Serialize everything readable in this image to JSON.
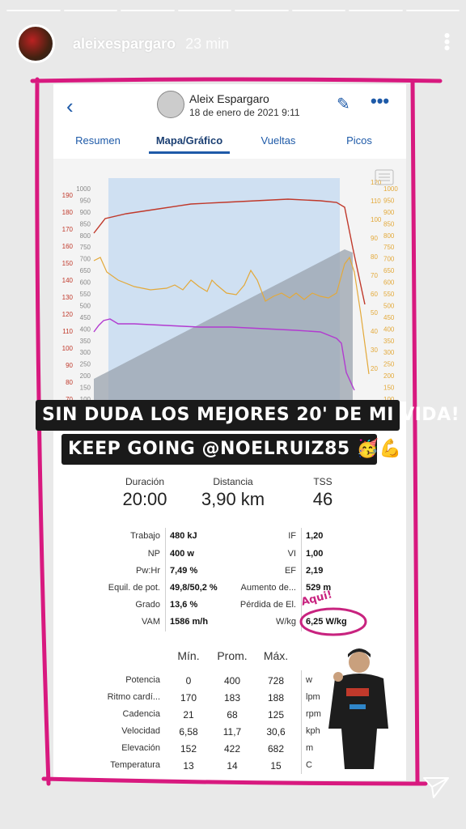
{
  "story": {
    "username": "aleixespargaro",
    "time": "23 min",
    "progress_segments": 8
  },
  "app": {
    "athlete_name": "Aleix Espargaro",
    "date": "18 de enero de 2021   9:11",
    "tabs": [
      {
        "label": "Resumen",
        "active": false
      },
      {
        "label": "Mapa/Gráfico",
        "active": true
      },
      {
        "label": "Vueltas",
        "active": false
      },
      {
        "label": "Picos",
        "active": false
      }
    ]
  },
  "overlay_text": {
    "line1": "SIN DUDA LOS MEJORES 20' DE MI VIDA!",
    "line2": "KEEP GOING @NOELRUIZ85 🥳💪"
  },
  "summary": [
    {
      "label": "Duración",
      "value": "20:00"
    },
    {
      "label": "Distancia",
      "value": "3,90 km"
    },
    {
      "label": "TSS",
      "value": "46"
    }
  ],
  "stats_left": [
    {
      "label": "Trabajo",
      "value": "480 kJ"
    },
    {
      "label": "NP",
      "value": "400 w"
    },
    {
      "label": "Pw:Hr",
      "value": "7,49 %"
    },
    {
      "label": "Equil. de pot.",
      "value": "49,8/50,2 %"
    },
    {
      "label": "Grado",
      "value": "13,6 %"
    },
    {
      "label": "VAM",
      "value": "1586 m/h"
    }
  ],
  "stats_right": [
    {
      "label": "IF",
      "value": "1,20"
    },
    {
      "label": "VI",
      "value": "1,00"
    },
    {
      "label": "EF",
      "value": "2,19"
    },
    {
      "label": "Aumento de...",
      "value": "529 m"
    },
    {
      "label": "Pérdida de El.",
      "value": ""
    },
    {
      "label": "W/kg",
      "value": "6,25 W/kg"
    }
  ],
  "annotation": "Aqui!",
  "table": {
    "headers": [
      "Mín.",
      "Prom.",
      "Máx."
    ],
    "rows": [
      {
        "label": "Potencia",
        "min": "0",
        "avg": "400",
        "max": "728",
        "unit": "w"
      },
      {
        "label": "Ritmo cardí...",
        "min": "170",
        "avg": "183",
        "max": "188",
        "unit": "lpm"
      },
      {
        "label": "Cadencia",
        "min": "21",
        "avg": "68",
        "max": "125",
        "unit": "rpm"
      },
      {
        "label": "Velocidad",
        "min": "6,58",
        "avg": "11,7",
        "max": "30,6",
        "unit": "kph"
      },
      {
        "label": "Elevación",
        "min": "152",
        "avg": "422",
        "max": "682",
        "unit": "m"
      },
      {
        "label": "Temperatura",
        "min": "13",
        "avg": "14",
        "max": "15",
        "unit": "C"
      }
    ]
  },
  "chart_axes": {
    "hr_ticks": [
      "190",
      "180",
      "170",
      "160",
      "150",
      "140",
      "130",
      "120",
      "110",
      "100",
      "90",
      "80",
      "70"
    ],
    "power_ticks": [
      "1000",
      "950",
      "900",
      "850",
      "800",
      "750",
      "700",
      "650",
      "600",
      "550",
      "500",
      "450",
      "400",
      "350",
      "300",
      "250",
      "200",
      "150",
      "100"
    ],
    "right_orange_ticks": [
      "120",
      "110",
      "100",
      "90",
      "80",
      "70",
      "60",
      "50",
      "40",
      "30",
      "20"
    ],
    "right_purple_ticks": [
      "1000",
      "950",
      "900",
      "850",
      "800",
      "750",
      "700",
      "650",
      "600",
      "550",
      "500",
      "450",
      "400",
      "350",
      "300",
      "250",
      "200",
      "150",
      "100"
    ]
  },
  "colors": {
    "frame": "#d8197f",
    "accent": "#1e5aa8",
    "hr": "#c0392b",
    "cadence": "#e3a93a",
    "power": "#b23bd0"
  }
}
